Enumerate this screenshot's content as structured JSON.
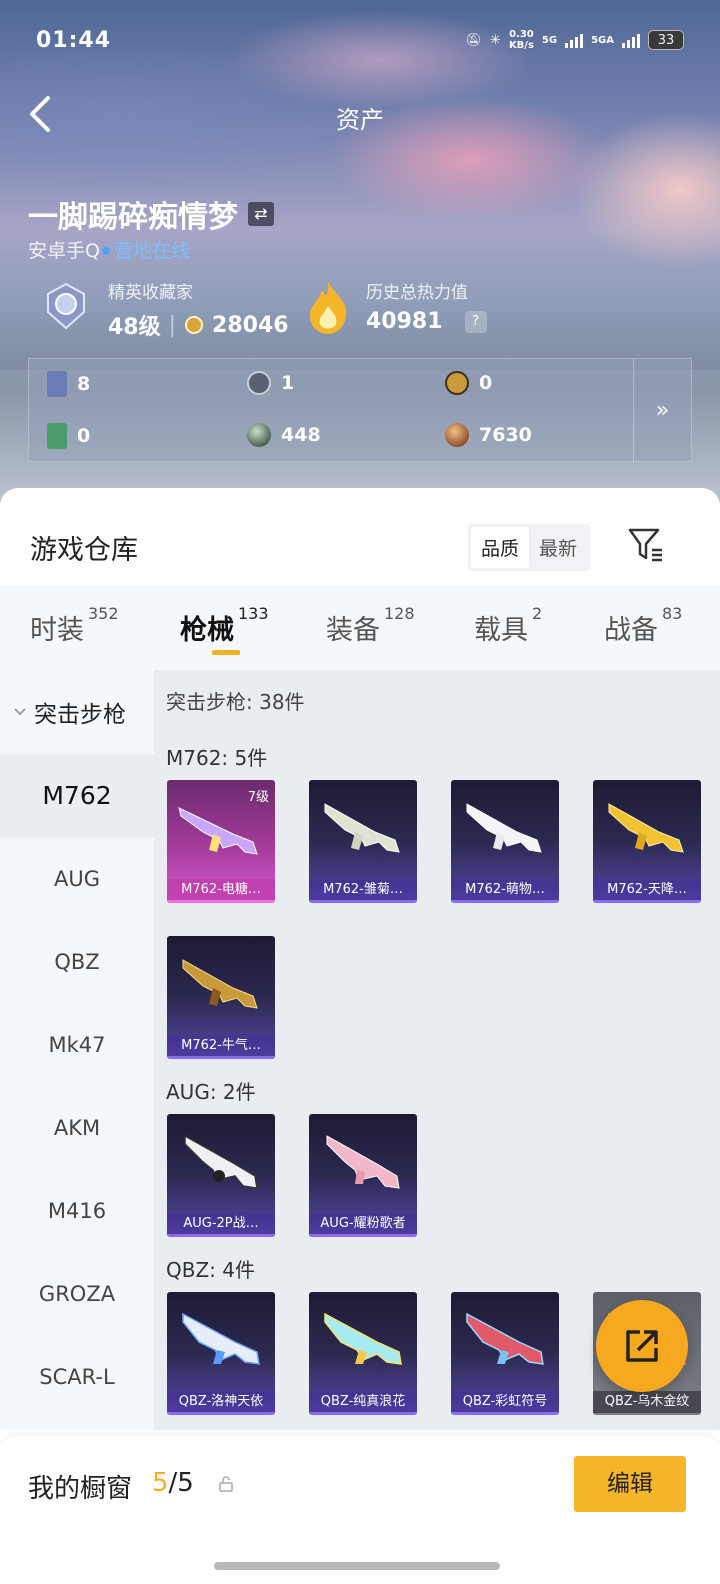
{
  "status_bar": {
    "time": "01:44",
    "net_speed": "0.30",
    "net_unit": "KB/s",
    "sim1": "5G",
    "sim2": "5GA",
    "battery": "33"
  },
  "nav": {
    "title": "资产"
  },
  "profile": {
    "name": "一脚踢碎痴情梦",
    "platform": "安卓手Q",
    "online_status": "营地在线",
    "collector_label": "精英收藏家",
    "level": "48级",
    "collector_points": "28046",
    "heat_label": "历史总热力值",
    "heat_value": "40981",
    "help": "?"
  },
  "assets": [
    {
      "icon": "card-icon",
      "value": "8",
      "color": "#6b7bb8"
    },
    {
      "icon": "coin-icon",
      "value": "1",
      "color": "#5a6175"
    },
    {
      "icon": "gold-badge-icon",
      "value": "0",
      "color": "#c89a3a"
    },
    {
      "icon": "green-card-icon",
      "value": "0",
      "color": "#4a9a6a"
    },
    {
      "icon": "sphere-icon",
      "value": "448",
      "color": "#607565"
    },
    {
      "icon": "bronze-coin-icon",
      "value": "7630",
      "color": "#a0643a"
    }
  ],
  "assets_more": "»",
  "warehouse": {
    "title": "游戏仓库",
    "sort_quality": "品质",
    "sort_latest": "最新"
  },
  "tabs": [
    {
      "label": "时装",
      "count": "352"
    },
    {
      "label": "枪械",
      "count": "133"
    },
    {
      "label": "装备",
      "count": "128"
    },
    {
      "label": "载具",
      "count": "2"
    },
    {
      "label": "战备",
      "count": "83"
    }
  ],
  "sidebar": {
    "header": "突击步枪",
    "items": [
      "M762",
      "AUG",
      "QBZ",
      "Mk47",
      "AKM",
      "M416",
      "GROZA",
      "SCAR-L"
    ]
  },
  "content": {
    "total": "突击步枪: 38件",
    "groups": [
      {
        "title": "M762: 5件",
        "items": [
          {
            "name": "M762-电糖…",
            "level": "7级"
          },
          {
            "name": "M762-雏菊…"
          },
          {
            "name": "M762-萌物…"
          },
          {
            "name": "M762-天降…"
          },
          {
            "name": "M762-牛气…"
          }
        ]
      },
      {
        "title": "AUG: 2件",
        "items": [
          {
            "name": "AUG-2P战…"
          },
          {
            "name": "AUG-耀粉歌者"
          }
        ]
      },
      {
        "title": "QBZ: 4件",
        "items": [
          {
            "name": "QBZ-洛神天依"
          },
          {
            "name": "QBZ-纯真浪花"
          },
          {
            "name": "QBZ-彩虹符号"
          },
          {
            "name": "QBZ-乌木金纹"
          }
        ]
      }
    ]
  },
  "showcase": {
    "label": "我的橱窗",
    "current": "5",
    "total": "/5",
    "edit": "编辑"
  }
}
